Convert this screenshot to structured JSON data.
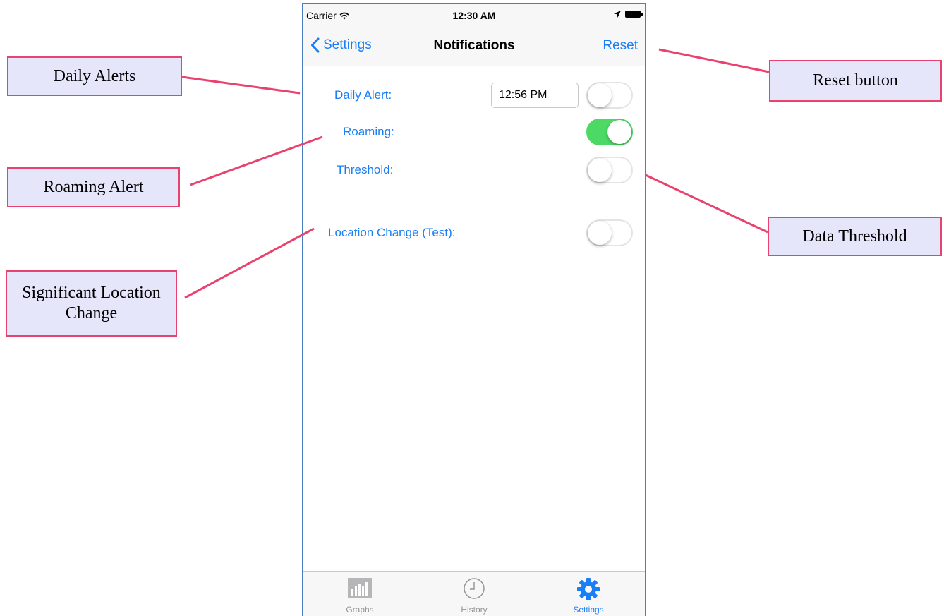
{
  "status_bar": {
    "carrier": "Carrier",
    "time": "12:30 AM"
  },
  "nav": {
    "back_label": "Settings",
    "title": "Notifications",
    "reset_label": "Reset"
  },
  "rows": {
    "daily_alert": {
      "label": "Daily Alert:",
      "time_value": "12:56 PM",
      "enabled": false
    },
    "roaming": {
      "label": "Roaming:",
      "enabled": true
    },
    "threshold": {
      "label": "Threshold:",
      "enabled": false
    },
    "location_change": {
      "label": "Location Change (Test):",
      "enabled": false
    }
  },
  "tabs": [
    {
      "label": "Graphs",
      "icon": "bar-chart-icon",
      "active": false
    },
    {
      "label": "History",
      "icon": "clock-icon",
      "active": false
    },
    {
      "label": "Settings",
      "icon": "gear-icon",
      "active": true
    }
  ],
  "callouts": {
    "daily_alerts": "Daily Alerts",
    "roaming_alert": "Roaming Alert",
    "significant_location": "Significant Location Change",
    "reset_button": "Reset button",
    "data_threshold": "Data Threshold"
  },
  "colors": {
    "ios_blue": "#1a7ef5",
    "toggle_on": "#4cd964",
    "callout_border": "#e8436f",
    "callout_fill": "#e6e6fb",
    "phone_border": "#4a7ec0"
  }
}
